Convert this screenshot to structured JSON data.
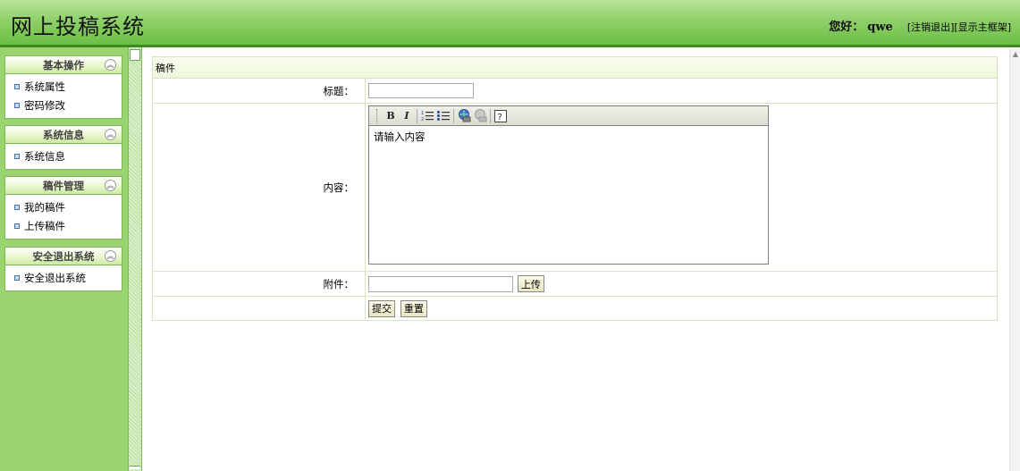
{
  "header": {
    "app_title": "网上投稿系统",
    "greeting": "您好：",
    "username": "qwe",
    "logout_link": "[注销退出]",
    "show_frame_link": "[显示主框架]"
  },
  "sidebar": {
    "groups": [
      {
        "title": "基本操作",
        "items": [
          "系统属性",
          "密码修改"
        ]
      },
      {
        "title": "系统信息",
        "items": [
          "系统信息"
        ]
      },
      {
        "title": "稿件管理",
        "items": [
          "我的稿件",
          "上传稿件"
        ]
      },
      {
        "title": "安全退出系统",
        "items": [
          "安全退出系统"
        ]
      }
    ]
  },
  "form": {
    "caption": "稿件",
    "title_label": "标题：",
    "title_value": "",
    "content_label": "内容：",
    "content_text": "请输入内容",
    "attachment_label": "附件：",
    "attachment_value": "",
    "upload_button": "上传",
    "submit_button": "提交",
    "reset_button": "重置"
  },
  "editor_toolbar": {
    "bold": "B",
    "italic": "I",
    "icons": [
      "bold-icon",
      "italic-icon",
      "ordered-list-icon",
      "unordered-list-icon",
      "link-icon",
      "unlink-icon",
      "help-icon"
    ]
  }
}
